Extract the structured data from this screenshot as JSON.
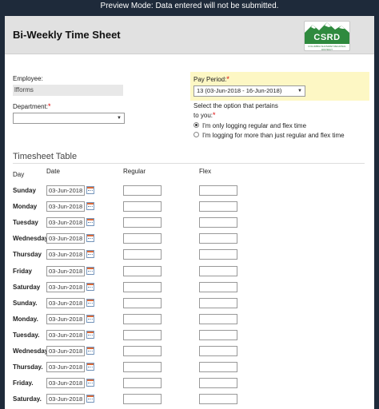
{
  "banner": "Preview Mode: Data entered will not be submitted.",
  "form": {
    "title": "Bi-Weekly Time Sheet",
    "logo_text": "CSRD",
    "logo_sub": "COLUMBIA SHUSWAP REGIONAL DISTRICT",
    "employee_label": "Employee:",
    "employee_value": "lfforms",
    "department_label": "Department:",
    "department_value": "",
    "pay_period_label": "Pay Period:",
    "pay_period_value": "13 (03-Jun-2018 - 16-Jun-2018)",
    "option_prompt_line1": "Select the option that pertains",
    "option_prompt_line2": "to you:",
    "options": [
      {
        "label": "I'm only logging regular and flex time",
        "selected": true
      },
      {
        "label": "I'm logging for more than just regular and flex time",
        "selected": false
      }
    ],
    "required_mark": "*"
  },
  "timesheet": {
    "title": "Timesheet Table",
    "columns": {
      "day": "Day",
      "date": "Date",
      "regular": "Regular",
      "flex": "Flex"
    },
    "rows": [
      {
        "day": "Sunday",
        "date": "03-Jun-2018"
      },
      {
        "day": "Monday",
        "date": "03-Jun-2018"
      },
      {
        "day": "Tuesday",
        "date": "03-Jun-2018"
      },
      {
        "day": "Wednesday",
        "date": "03-Jun-2018"
      },
      {
        "day": "Thursday",
        "date": "03-Jun-2018"
      },
      {
        "day": "Friday",
        "date": "03-Jun-2018"
      },
      {
        "day": "Saturday",
        "date": "03-Jun-2018"
      },
      {
        "day": "Sunday.",
        "date": "03-Jun-2018"
      },
      {
        "day": "Monday.",
        "date": "03-Jun-2018"
      },
      {
        "day": "Tuesday.",
        "date": "03-Jun-2018"
      },
      {
        "day": "Wednesday.",
        "date": "03-Jun-2018"
      },
      {
        "day": "Thursday.",
        "date": "03-Jun-2018"
      },
      {
        "day": "Friday.",
        "date": "03-Jun-2018"
      },
      {
        "day": "Saturday.",
        "date": "03-Jun-2018"
      }
    ]
  },
  "colors": {
    "background": "#1e2a3a",
    "highlight": "#fdf7c4",
    "required": "#dd0000",
    "logo_green": "#2f8a3e"
  }
}
